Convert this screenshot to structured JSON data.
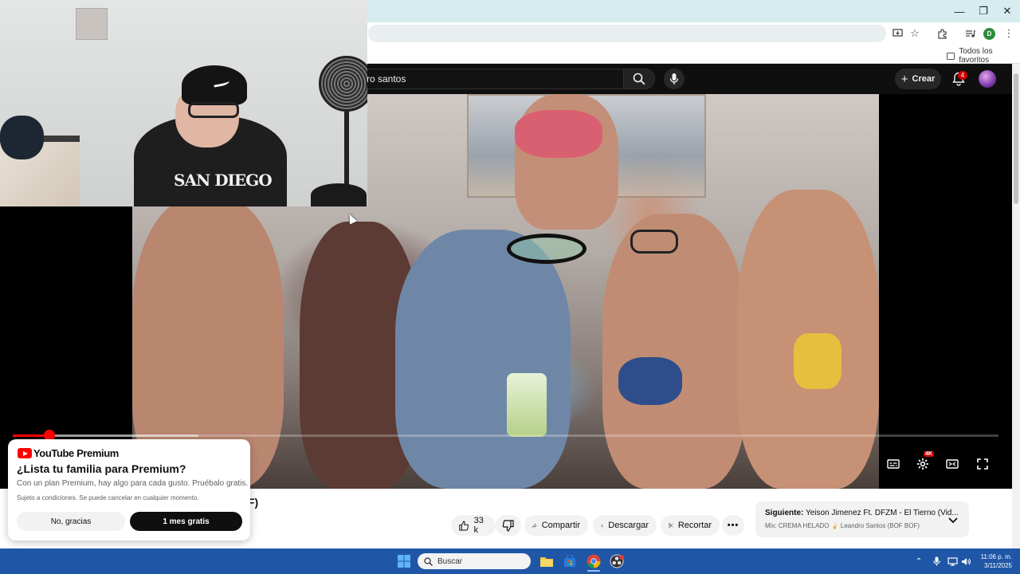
{
  "browser": {
    "bookmarks_folder_label": "Todos los favoritos",
    "profile_initial": "D"
  },
  "youtube": {
    "search_query": "ro santos",
    "create_label": "Crear",
    "notifications_count": "4",
    "video_title_fragment": "OF)",
    "like_count": "33 k",
    "share_label": "Compartir",
    "download_label": "Descargar",
    "clip_label": "Recortar",
    "quality_badge": "4K",
    "next_up": {
      "prefix": "Siguiente:",
      "title": "Yeison Jimenez Ft. DFZM - El Tierno (Vid...",
      "mix": "Mix: CREMA HELADO 🍦 Leandro Santos (BOF BOF)"
    },
    "progress_fraction": 0.037,
    "buffered_fraction": 0.188
  },
  "premium_popup": {
    "brand": "YouTube Premium",
    "title": "¿Lista tu familia para Premium?",
    "description": "Con un plan Premium, hay algo para cada gusto. Pruébalo gratis.",
    "terms": "Sujeto a condiciones. Se puede cancelar en cualquier momento.",
    "decline_label": "No, gracias",
    "accept_label": "1 mes gratis"
  },
  "webcam": {
    "shirt_text": "SAN DIEGO"
  },
  "taskbar": {
    "search_placeholder": "Buscar",
    "time": "11:06 p. m.",
    "date": "3/11/2025"
  },
  "colors": {
    "youtube_red": "#ff0000",
    "taskbar_blue": "#1f57a6",
    "header_dark": "#0f0f0f"
  }
}
